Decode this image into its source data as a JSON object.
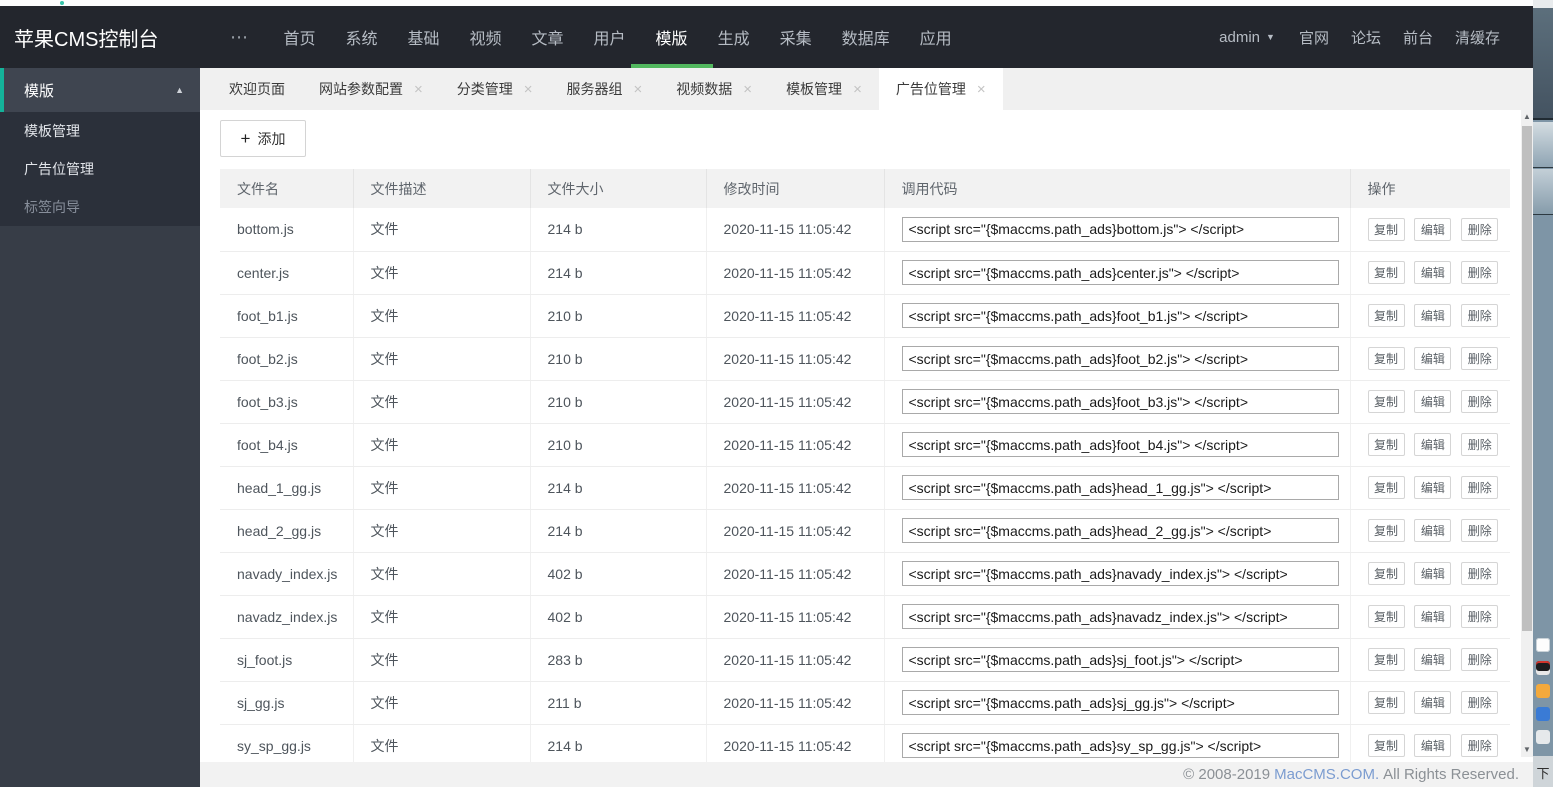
{
  "navbar": {
    "logo": "苹果CMS控制台",
    "more_icon": "⋯",
    "items": [
      {
        "label": "首页"
      },
      {
        "label": "系统"
      },
      {
        "label": "基础"
      },
      {
        "label": "视频"
      },
      {
        "label": "文章"
      },
      {
        "label": "用户"
      },
      {
        "label": "模版",
        "active": true
      },
      {
        "label": "生成"
      },
      {
        "label": "采集"
      },
      {
        "label": "数据库"
      },
      {
        "label": "应用"
      }
    ],
    "user": {
      "name": "admin",
      "caret_icon": "▼"
    },
    "links": [
      {
        "label": "官网"
      },
      {
        "label": "论坛"
      },
      {
        "label": "前台"
      },
      {
        "label": "清缓存"
      }
    ]
  },
  "sidebar": {
    "header": {
      "label": "模版",
      "collapse_icon": "▲"
    },
    "items": [
      {
        "label": "模板管理"
      },
      {
        "label": "广告位管理"
      },
      {
        "label": "标签向导",
        "muted": true
      }
    ]
  },
  "tabs": [
    {
      "label": "欢迎页面"
    },
    {
      "label": "网站参数配置",
      "closable": true
    },
    {
      "label": "分类管理",
      "closable": true
    },
    {
      "label": "服务器组",
      "closable": true
    },
    {
      "label": "视频数据",
      "closable": true
    },
    {
      "label": "模板管理",
      "closable": true
    },
    {
      "label": "广告位管理",
      "closable": true,
      "active": true
    }
  ],
  "tab_close_icon": "×",
  "toolbar": {
    "plus_icon": "+",
    "add_label": "添加"
  },
  "table": {
    "headers": [
      "文件名",
      "文件描述",
      "文件大小",
      "修改时间",
      "调用代码",
      "操作"
    ],
    "action_labels": {
      "copy": "复制",
      "edit": "编辑",
      "delete": "删除"
    },
    "rows": [
      {
        "name": "bottom.js",
        "desc": "文件",
        "size": "214 b",
        "time": "2020-11-15 11:05:42",
        "code": "<script src=\"{$maccms.path_ads}bottom.js\"> </script>"
      },
      {
        "name": "center.js",
        "desc": "文件",
        "size": "214 b",
        "time": "2020-11-15 11:05:42",
        "code": "<script src=\"{$maccms.path_ads}center.js\"> </script>"
      },
      {
        "name": "foot_b1.js",
        "desc": "文件",
        "size": "210 b",
        "time": "2020-11-15 11:05:42",
        "code": "<script src=\"{$maccms.path_ads}foot_b1.js\"> </script>"
      },
      {
        "name": "foot_b2.js",
        "desc": "文件",
        "size": "210 b",
        "time": "2020-11-15 11:05:42",
        "code": "<script src=\"{$maccms.path_ads}foot_b2.js\"> </script>"
      },
      {
        "name": "foot_b3.js",
        "desc": "文件",
        "size": "210 b",
        "time": "2020-11-15 11:05:42",
        "code": "<script src=\"{$maccms.path_ads}foot_b3.js\"> </script>"
      },
      {
        "name": "foot_b4.js",
        "desc": "文件",
        "size": "210 b",
        "time": "2020-11-15 11:05:42",
        "code": "<script src=\"{$maccms.path_ads}foot_b4.js\"> </script>"
      },
      {
        "name": "head_1_gg.js",
        "desc": "文件",
        "size": "214 b",
        "time": "2020-11-15 11:05:42",
        "code": "<script src=\"{$maccms.path_ads}head_1_gg.js\"> </script>"
      },
      {
        "name": "head_2_gg.js",
        "desc": "文件",
        "size": "214 b",
        "time": "2020-11-15 11:05:42",
        "code": "<script src=\"{$maccms.path_ads}head_2_gg.js\"> </script>"
      },
      {
        "name": "navady_index.js",
        "desc": "文件",
        "size": "402 b",
        "time": "2020-11-15 11:05:42",
        "code": "<script src=\"{$maccms.path_ads}navady_index.js\"> </script>"
      },
      {
        "name": "navadz_index.js",
        "desc": "文件",
        "size": "402 b",
        "time": "2020-11-15 11:05:42",
        "code": "<script src=\"{$maccms.path_ads}navadz_index.js\"> </script>"
      },
      {
        "name": "sj_foot.js",
        "desc": "文件",
        "size": "283 b",
        "time": "2020-11-15 11:05:42",
        "code": "<script src=\"{$maccms.path_ads}sj_foot.js\"> </script>"
      },
      {
        "name": "sj_gg.js",
        "desc": "文件",
        "size": "211 b",
        "time": "2020-11-15 11:05:42",
        "code": "<script src=\"{$maccms.path_ads}sj_gg.js\"> </script>"
      },
      {
        "name": "sy_sp_gg.js",
        "desc": "文件",
        "size": "214 b",
        "time": "2020-11-15 11:05:42",
        "code": "<script src=\"{$maccms.path_ads}sy_sp_gg.js\"> </script>"
      }
    ]
  },
  "footer": {
    "prefix": "© 2008-2019",
    "link": "MacCMS.COM.",
    "suffix": "All Rights Reserved."
  },
  "scrollbar": {
    "up_icon": "▲",
    "down_icon": "▼"
  },
  "desktop": {
    "partial_label": "下"
  },
  "colors": {
    "navbar_bg": "#23262d",
    "nav_active_underline": "#52b85f",
    "sidebar_bg": "#373d47",
    "sidebar_submenu_bg": "#2b303a",
    "sidebar_accent": "#14b39a",
    "tabbar_bg": "#f0f0f0",
    "table_header_bg": "#f2f2f2",
    "footer_link": "#7b9cd0"
  }
}
